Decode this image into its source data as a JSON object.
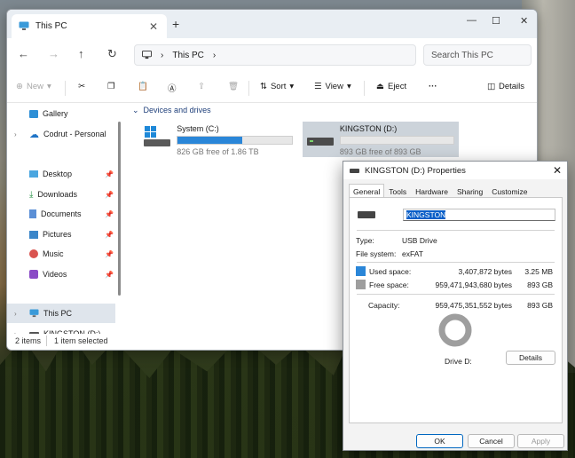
{
  "explorer": {
    "tab_title": "This PC",
    "address": "This PC",
    "search_placeholder": "Search This PC",
    "toolbar": {
      "new": "New",
      "sort": "Sort",
      "view": "View",
      "eject": "Eject",
      "details": "Details"
    },
    "sidebar": {
      "gallery": "Gallery",
      "codrut": "Codrut - Personal",
      "desktop": "Desktop",
      "downloads": "Downloads",
      "documents": "Documents",
      "pictures": "Pictures",
      "music": "Music",
      "videos": "Videos",
      "this_pc": "This PC",
      "kingston": "KINGSTON (D:)"
    },
    "section_title": "Devices and drives",
    "drives": [
      {
        "name": "System (C:)",
        "free_text": "826 GB free of 1.86 TB",
        "used_fraction": 0.566
      },
      {
        "name": "KINGSTON (D:)",
        "free_text": "893 GB free of 893 GB",
        "used_fraction": 0.0
      }
    ],
    "status": {
      "items": "2 items",
      "selected": "1 item selected"
    }
  },
  "props": {
    "title": "KINGSTON (D:) Properties",
    "tabs": [
      "General",
      "Tools",
      "Hardware",
      "Sharing",
      "Customize"
    ],
    "label_value": "KINGSTON",
    "type_label": "Type:",
    "type_value": "USB Drive",
    "fs_label": "File system:",
    "fs_value": "exFAT",
    "used_label": "Used space:",
    "used_bytes": "3,407,872 bytes",
    "used_size": "3.25 MB",
    "free_label": "Free space:",
    "free_bytes": "959,471,943,680 bytes",
    "free_size": "893 GB",
    "cap_label": "Capacity:",
    "cap_bytes": "959,475,351,552 bytes",
    "cap_size": "893 GB",
    "drive_label": "Drive D:",
    "details_btn": "Details",
    "ok": "OK",
    "cancel": "Cancel",
    "apply": "Apply",
    "colors": {
      "used": "#2a86d8",
      "free": "#9e9e9e"
    }
  }
}
